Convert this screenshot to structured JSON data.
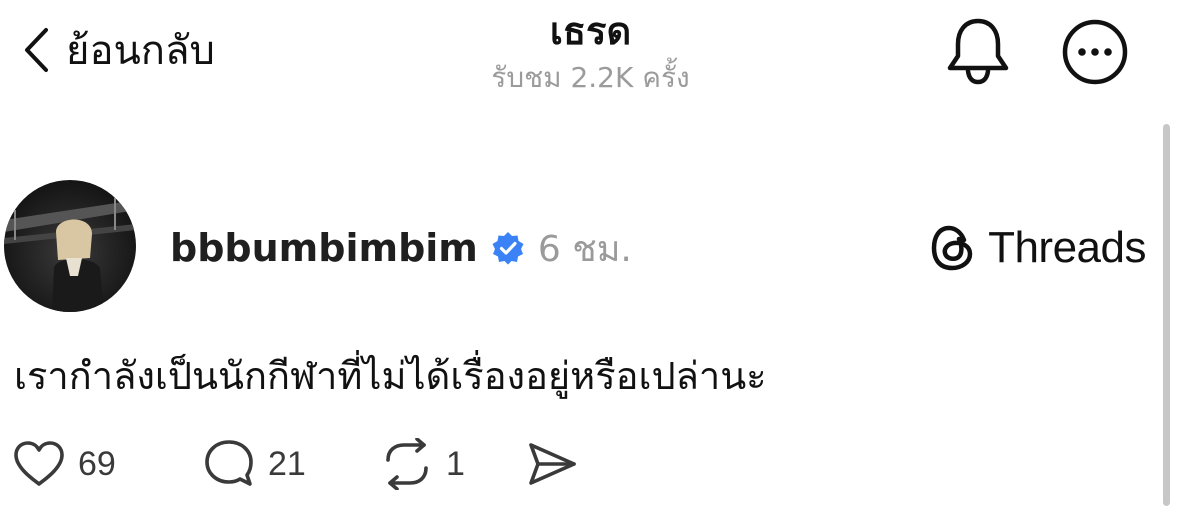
{
  "header": {
    "back_label": "ย้อนกลับ",
    "title": "เธรด",
    "subtitle": "รับชม 2.2K ครั้ง",
    "icons": {
      "back": "chevron-left-icon",
      "notifications": "bell-icon",
      "more": "more-horizontal-icon"
    }
  },
  "post": {
    "username": "bbbumbimbim",
    "verified": true,
    "time": "6 ชม.",
    "brand_label": "Threads",
    "text": "เรากำลังเป็นนักกีฬาที่ไม่ได้เรื่องอยู่หรือเปล่านะ",
    "actions": {
      "likes": "69",
      "replies": "21",
      "reposts": "1"
    }
  },
  "colors": {
    "verified_badge": "#3b82f6",
    "muted_text": "#9a9a9a",
    "scrollbar": "#c7c7c7"
  }
}
